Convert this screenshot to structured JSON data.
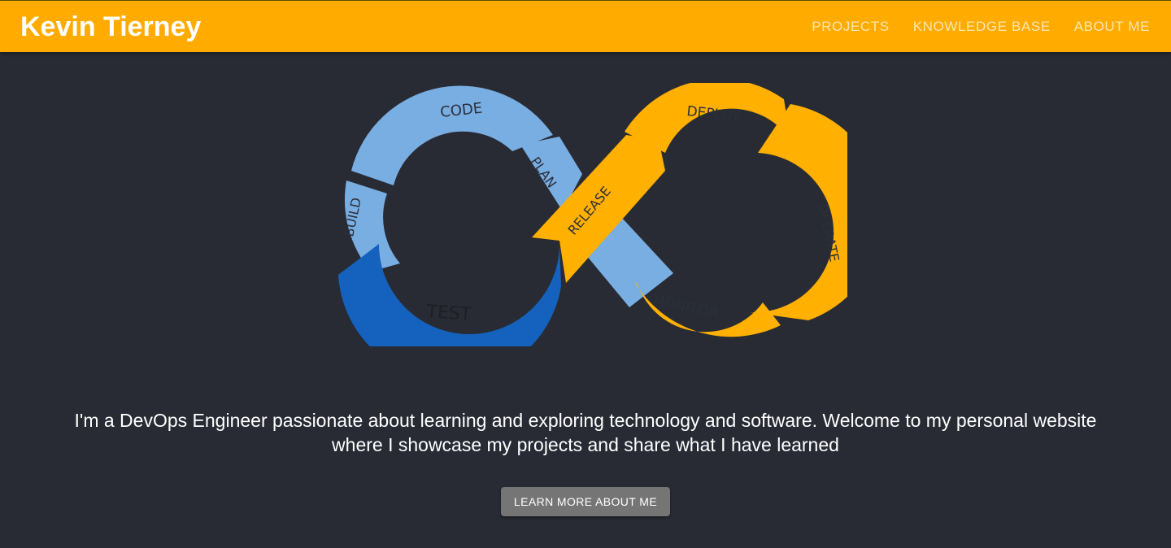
{
  "header": {
    "brand": "Kevin Tierney",
    "nav": [
      "PROJECTS",
      "KNOWLEDGE BASE",
      "ABOUT ME"
    ]
  },
  "hero_image": {
    "stages": {
      "code": "CODE",
      "plan": "PLAN",
      "build": "BUILD",
      "test": "TEST",
      "release": "RELEASE",
      "deploy": "DEPLOY",
      "operate": "OPERATE",
      "monitor": "MONITOR"
    },
    "colors": {
      "light_blue": "#79aee3",
      "dark_blue": "#1462bd",
      "orange": "#ffb000",
      "label": "#2b2f3a"
    }
  },
  "intro": {
    "line1": "I'm a DevOps Engineer passionate about learning and exploring technology and software. Welcome to my personal website",
    "line2": "where I showcase my projects and share what I have learned"
  },
  "cta": {
    "label": "LEARN MORE ABOUT ME"
  },
  "colors": {
    "header_bg": "#ffab00",
    "page_bg": "#282b34",
    "button_bg": "#757575"
  }
}
